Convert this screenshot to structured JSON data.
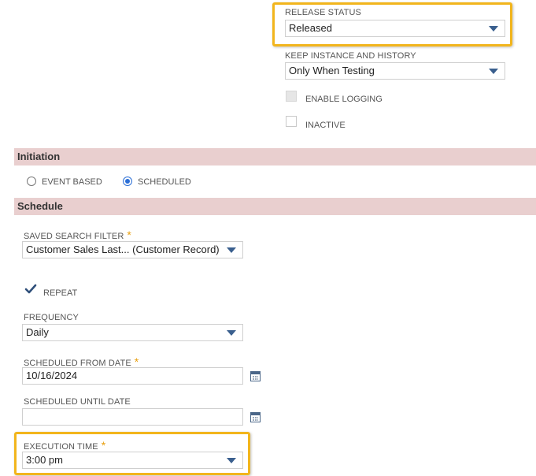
{
  "release_status": {
    "label": "RELEASE STATUS",
    "value": "Released"
  },
  "keep_instance": {
    "label": "KEEP INSTANCE AND HISTORY",
    "value": "Only When Testing"
  },
  "enable_logging": {
    "label": "ENABLE LOGGING",
    "checked": false,
    "disabled": true
  },
  "inactive": {
    "label": "INACTIVE",
    "checked": false
  },
  "initiation": {
    "title": "Initiation",
    "options": [
      {
        "label": "EVENT BASED",
        "selected": false
      },
      {
        "label": "SCHEDULED",
        "selected": true
      }
    ]
  },
  "schedule": {
    "title": "Schedule",
    "saved_search": {
      "label": "SAVED SEARCH FILTER",
      "required": "*",
      "value": "Customer Sales Last... (Customer Record)"
    },
    "repeat": {
      "label": "REPEAT",
      "checked": true
    },
    "frequency": {
      "label": "FREQUENCY",
      "value": "Daily"
    },
    "from_date": {
      "label": "SCHEDULED FROM DATE",
      "required": "*",
      "value": "10/16/2024"
    },
    "until_date": {
      "label": "SCHEDULED UNTIL DATE",
      "value": ""
    },
    "execution_time": {
      "label": "EXECUTION TIME",
      "required": "*",
      "value": "3:00 pm"
    }
  },
  "colors": {
    "section_bg": "#e9cfcf",
    "highlight": "#f2b51c",
    "required": "#e8a010",
    "accent": "#2a6ed6"
  }
}
